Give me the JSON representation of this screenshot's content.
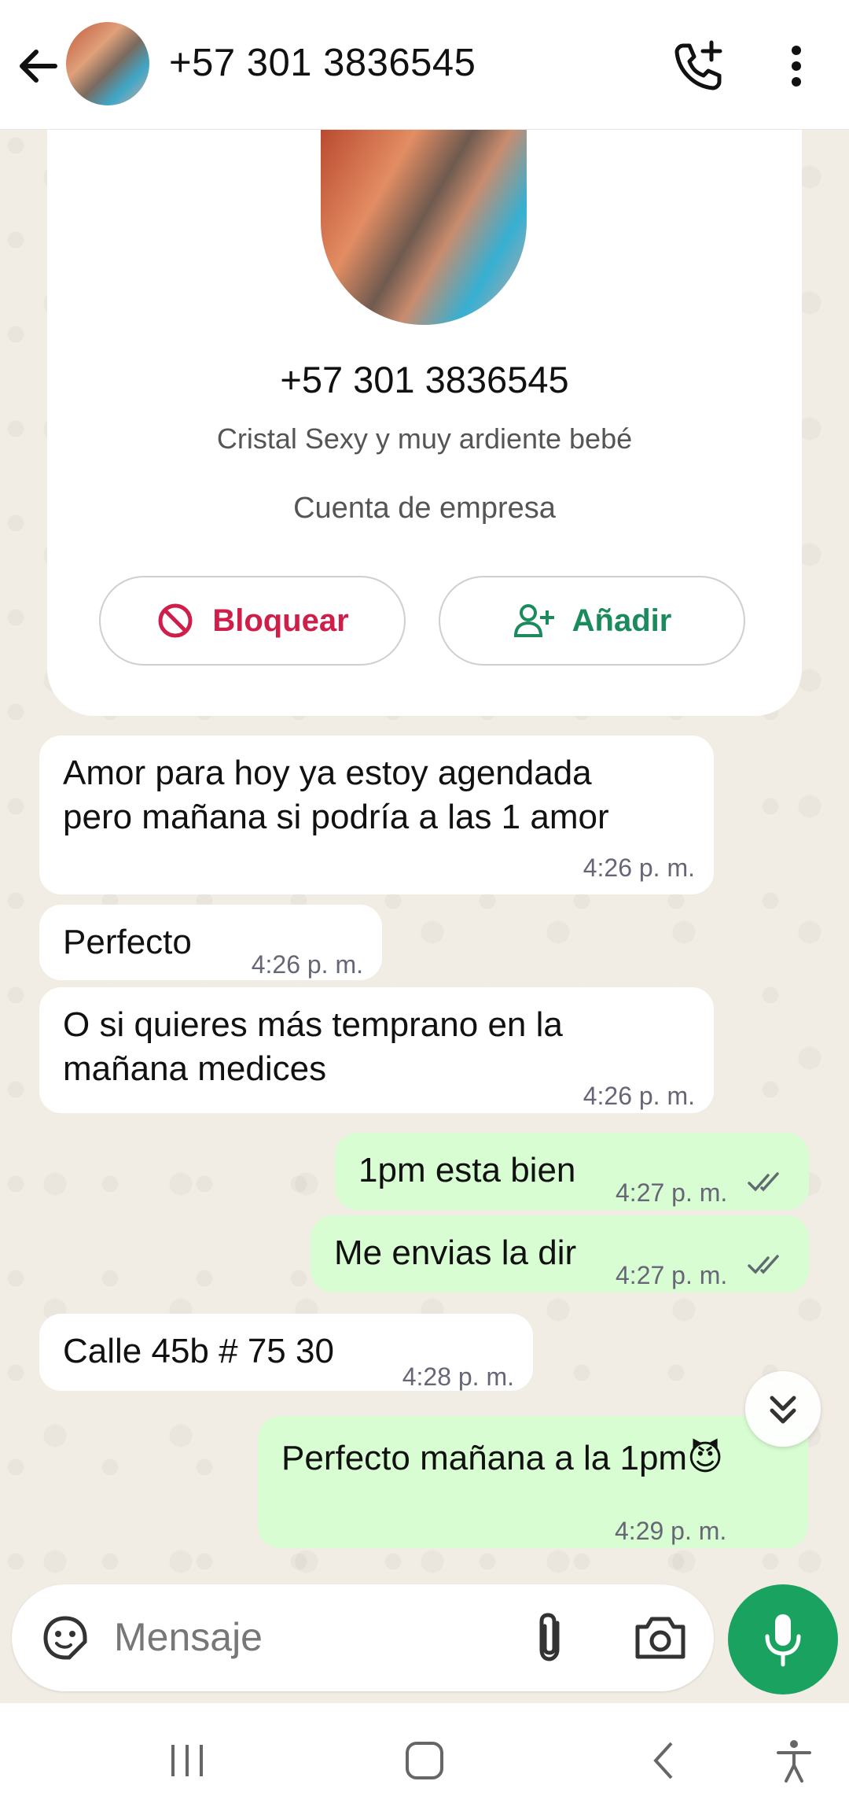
{
  "header": {
    "title": "+57 301 3836545"
  },
  "profile_card": {
    "phone": "+57 301 3836545",
    "name": "Cristal Sexy y muy ardiente bebé",
    "account_type": "Cuenta de empresa",
    "block_label": "Bloquear",
    "add_label": "Añadir"
  },
  "messages": [
    {
      "direction": "in",
      "text_line1": "Amor para hoy ya estoy agendada",
      "text_line2": "pero mañana si podría a las 1 amor",
      "time": "4:26 p. m."
    },
    {
      "direction": "in",
      "text": "Perfecto",
      "time": "4:26 p. m."
    },
    {
      "direction": "in",
      "text_line1": "O si quieres más temprano en la",
      "text_line2": "mañana medices",
      "time": "4:26 p. m."
    },
    {
      "direction": "out",
      "text": "1pm esta bien",
      "time": "4:27 p. m.",
      "status": "read"
    },
    {
      "direction": "out",
      "text": "Me envias la dir",
      "time": "4:27 p. m.",
      "status": "read"
    },
    {
      "direction": "in",
      "text": "Calle 45b # 75 30",
      "time": "4:28 p. m."
    },
    {
      "direction": "out",
      "text": "Perfecto mañana a la 1pm😈",
      "time": "4:29 p. m.",
      "status": "read"
    }
  ],
  "composer": {
    "placeholder": "Mensaje"
  },
  "icons": {
    "back": "arrow-left-icon",
    "call_add": "phone-plus-icon",
    "more": "more-vertical-icon",
    "emoji": "sticker-icon",
    "attach": "paperclip-icon",
    "camera": "camera-icon",
    "mic": "microphone-icon",
    "scroll": "double-chevron-down-icon"
  },
  "colors": {
    "accent_green": "#1aa260",
    "out_bubble": "#d9fdd3",
    "block_red": "#cf1e4a",
    "read_ticks": "#53bdeb"
  }
}
